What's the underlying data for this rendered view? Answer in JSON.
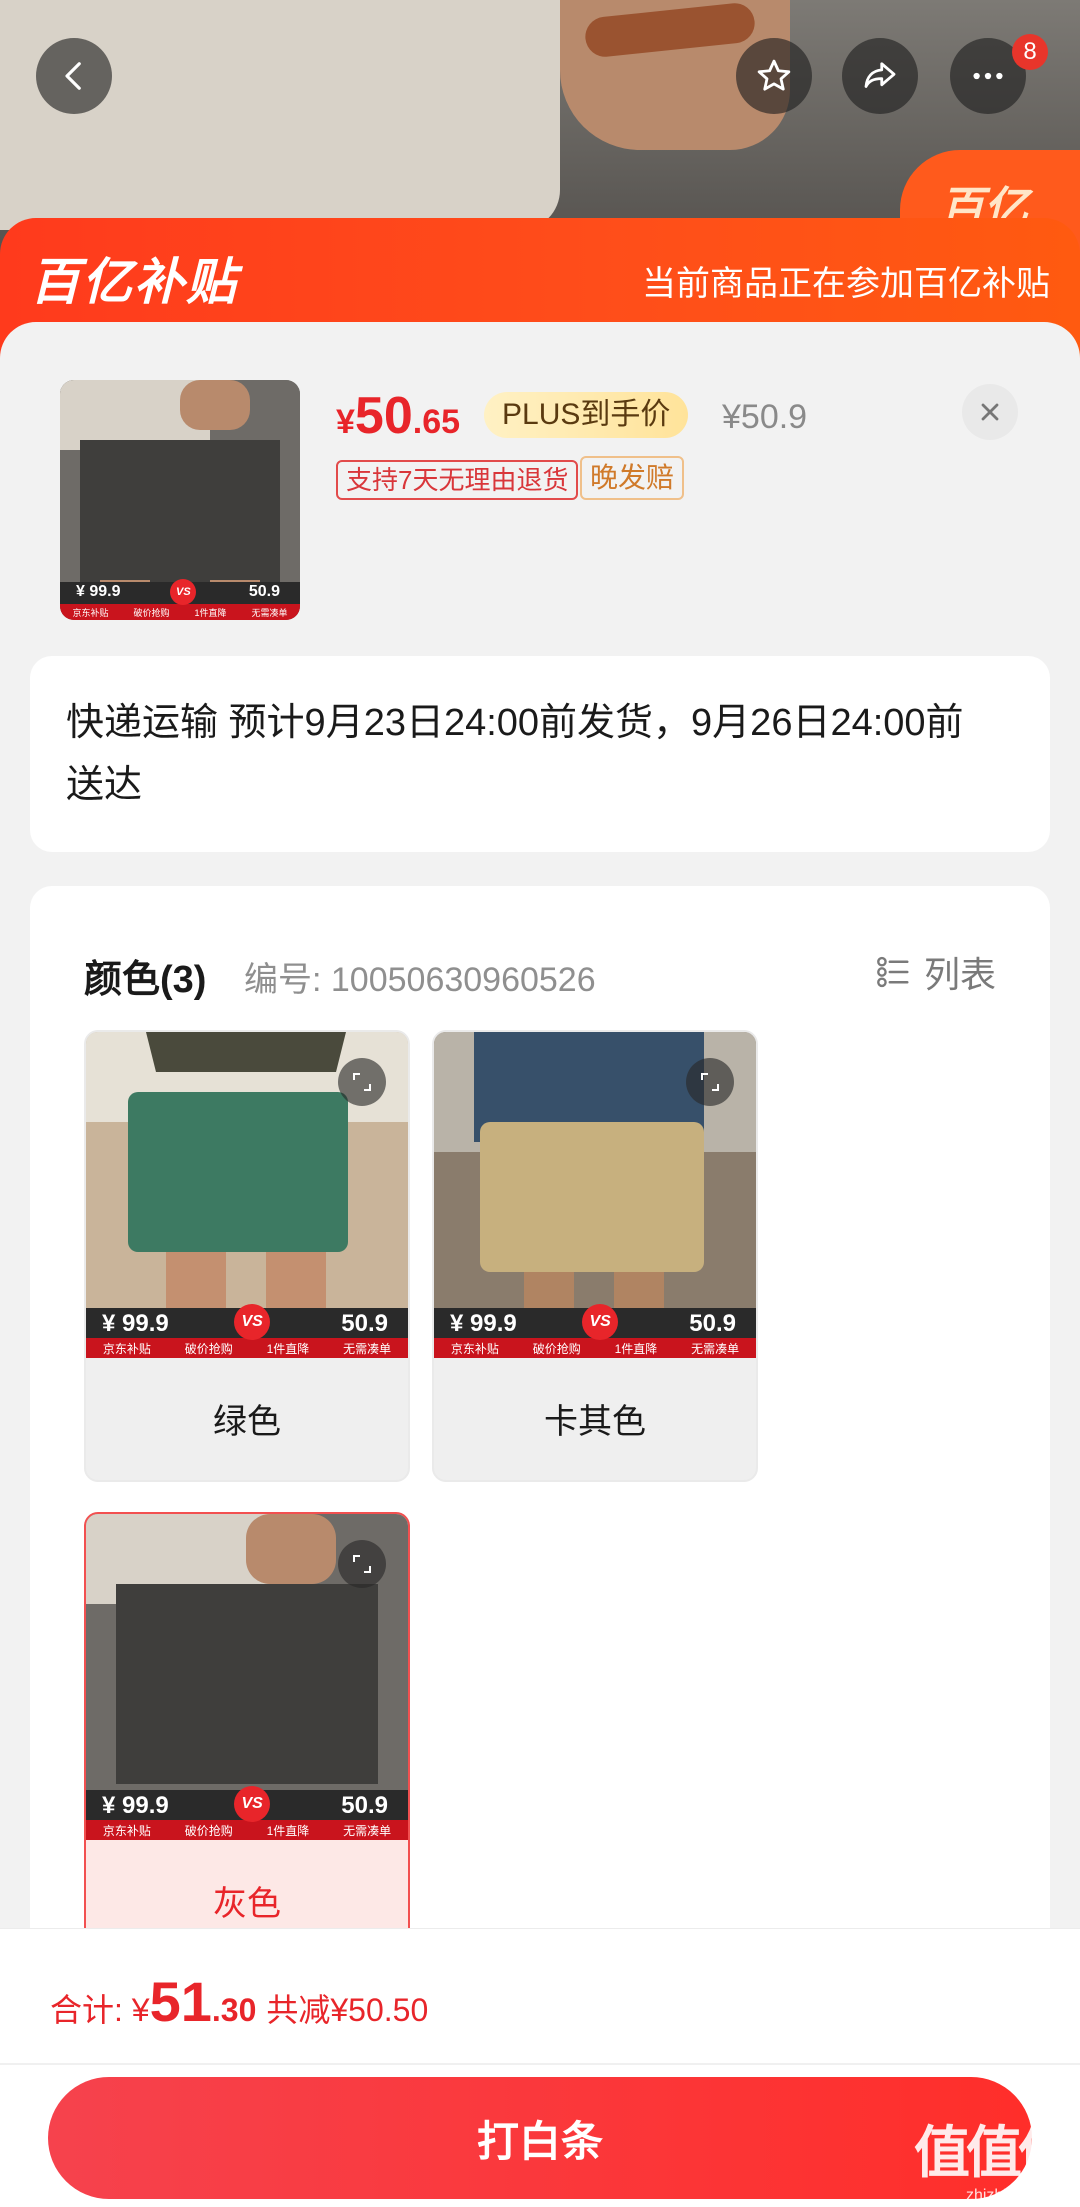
{
  "banner": {
    "logo": "百亿补贴",
    "text": "当前商品正在参加百亿补贴",
    "corner": "百亿"
  },
  "topbar": {
    "badge_count": "8"
  },
  "product": {
    "price_currency": "¥",
    "price_int": "50",
    "price_dec": ".65",
    "plus_label": "PLUS到手价",
    "original_price": "¥50.9",
    "tags": [
      "支持7天无理由退货",
      "晚发赔"
    ]
  },
  "strip": {
    "left": "¥ 99.9",
    "vs": "VS",
    "right": "50.9",
    "items": [
      "京东补贴",
      "破价抢购",
      "1件直降",
      "无需凑单"
    ]
  },
  "delivery": {
    "text": "快递运输 预计9月23日24:00前发货，9月26日24:00前送达"
  },
  "spec": {
    "title": "颜色(3)",
    "sku": "编号: 10050630960526",
    "list_label": "列表",
    "options": [
      {
        "name": "绿色",
        "selected": false
      },
      {
        "name": "卡其色",
        "selected": false
      },
      {
        "name": "灰色",
        "selected": true
      }
    ]
  },
  "footer": {
    "total_label": "合计: ",
    "currency": "¥",
    "total_int": "51",
    "total_dec": ".30",
    "saved": "共减¥50.50",
    "pay_button": "打白条",
    "watermark": "值值值",
    "watermark_site": "zhizhizhi.com"
  },
  "colors": {
    "accent": "#e8252a",
    "banner": "#ff4d1a",
    "pay_button": "#ff2e2a"
  }
}
